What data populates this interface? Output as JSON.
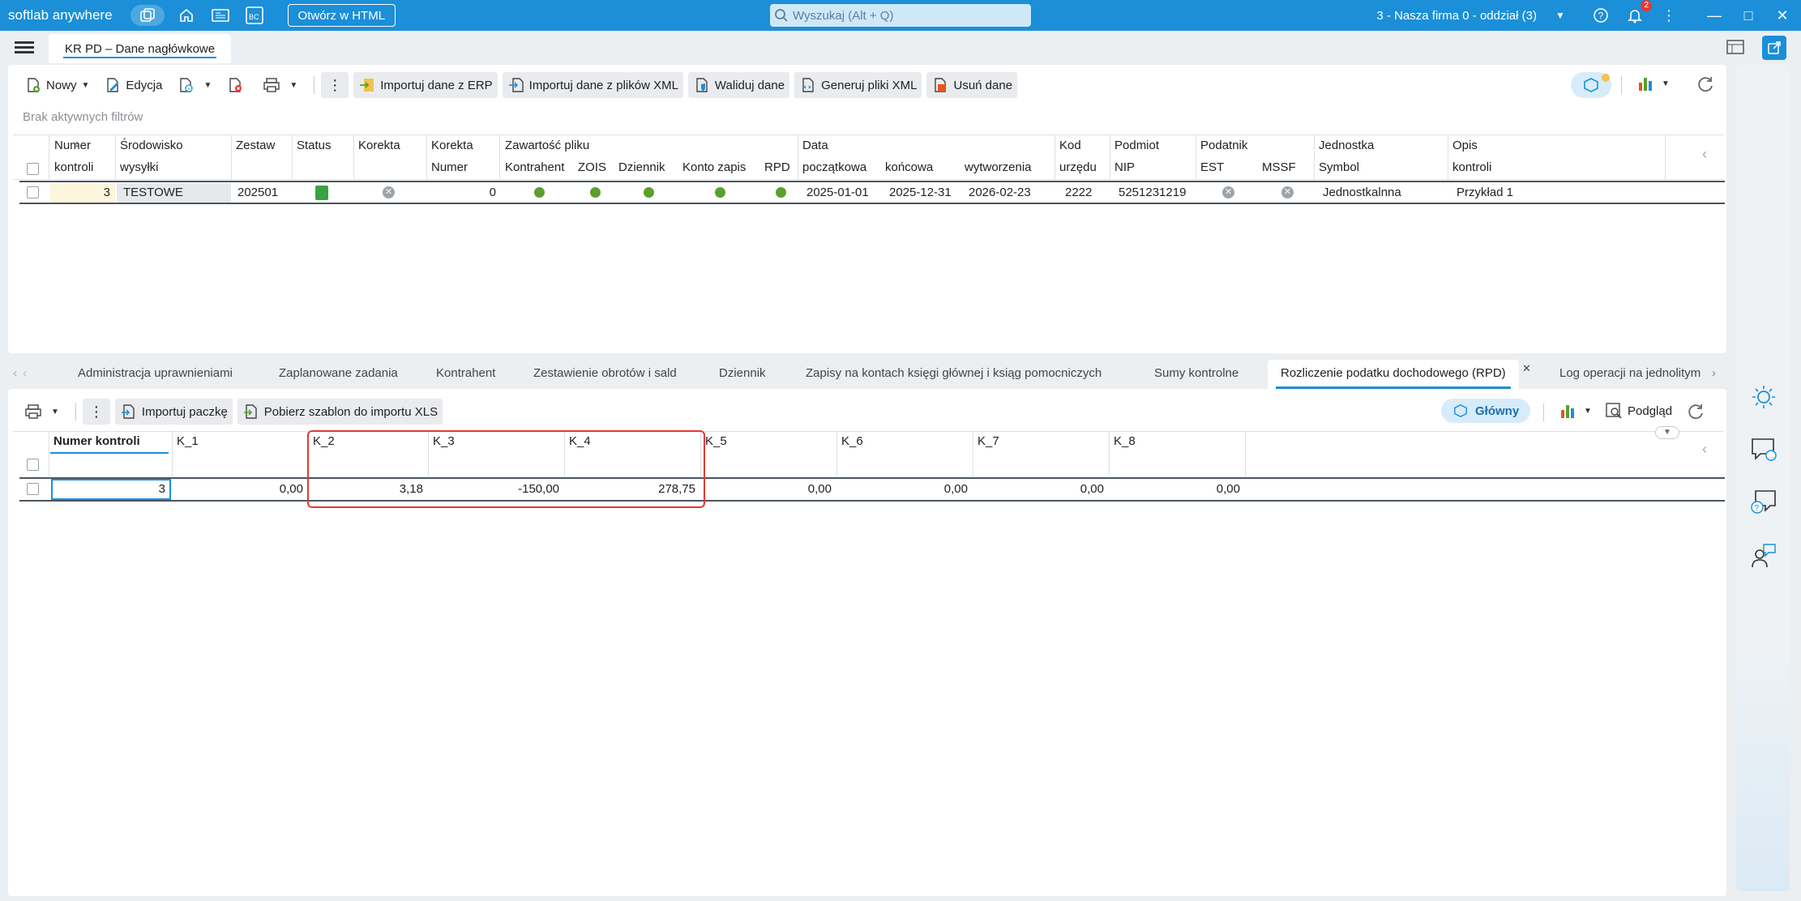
{
  "app": {
    "title": "softlab anywhere",
    "open_html": "Otwórz w HTML",
    "search_placeholder": "Wyszukaj (Alt + Q)",
    "company": "3 - Nasza firma 0 - oddział (3)",
    "notifications": "2"
  },
  "doc_tab": {
    "label": "KR PD – Dane nagłówkowe"
  },
  "top_toolbar": {
    "new": "Nowy",
    "edit": "Edycja",
    "import_erp": "Importuj dane z ERP",
    "import_xml": "Importuj dane z plików XML",
    "validate": "Waliduj dane",
    "generate_xml": "Generuj pliki XML",
    "delete": "Usuń dane"
  },
  "filters_text": "Brak aktywnych filtrów",
  "top_grid": {
    "headers_row1": [
      "Numer",
      "Środowisko",
      "Zestaw",
      "Status",
      "Korekta",
      "Korekta",
      "Zawartość pliku",
      "Data",
      "Kod",
      "Podmiot",
      "Podatnik",
      "Jednostka",
      "Opis"
    ],
    "headers_row2": [
      "kontroli",
      "wysyłki",
      "Numer",
      "Kontrahent",
      "ZOIS",
      "Dziennik",
      "Konto zapis",
      "RPD",
      "początkowa",
      "końcowa",
      "wytworzenia",
      "urzędu",
      "NIP",
      "EST",
      "MSSF",
      "Symbol",
      "kontroli"
    ],
    "row": {
      "numer": "3",
      "srodowisko": "TESTOWE",
      "zestaw": "202501",
      "korekta_numer": "0",
      "data_pocz": "2025-01-01",
      "data_konc": "2025-12-31",
      "data_wytw": "2026-02-23",
      "kod_urzedu": "2222",
      "nip": "5251231219",
      "symbol": "Jednostkalnna",
      "opis": "Przykład 1"
    }
  },
  "bottom_tabs": [
    "Administracja uprawnieniami",
    "Zaplanowane zadania",
    "Kontrahent",
    "Zestawienie obrotów i sald",
    "Dziennik",
    "Zapisy na kontach księgi głównej i ksiąg pomocniczych",
    "Sumy kontrolne",
    "Rozliczenie podatku dochodowego (RPD)",
    "Log operacji na jednolitym"
  ],
  "bottom_toolbar": {
    "import_package": "Importuj paczkę",
    "download_template": "Pobierz szablon do importu XLS",
    "main": "Główny",
    "preview": "Podgląd"
  },
  "bottom_grid": {
    "headers": [
      "Numer kontroli",
      "K_1",
      "K_2",
      "K_3",
      "K_4",
      "K_5",
      "K_6",
      "K_7",
      "K_8"
    ],
    "row": [
      "3",
      "0,00",
      "3,18",
      "-150,00",
      "278,75",
      "0,00",
      "0,00",
      "0,00",
      "0,00"
    ]
  },
  "colors": {
    "accent": "#1b8fd8",
    "highlight": "#e53935",
    "status_green": "#5aa02c"
  }
}
